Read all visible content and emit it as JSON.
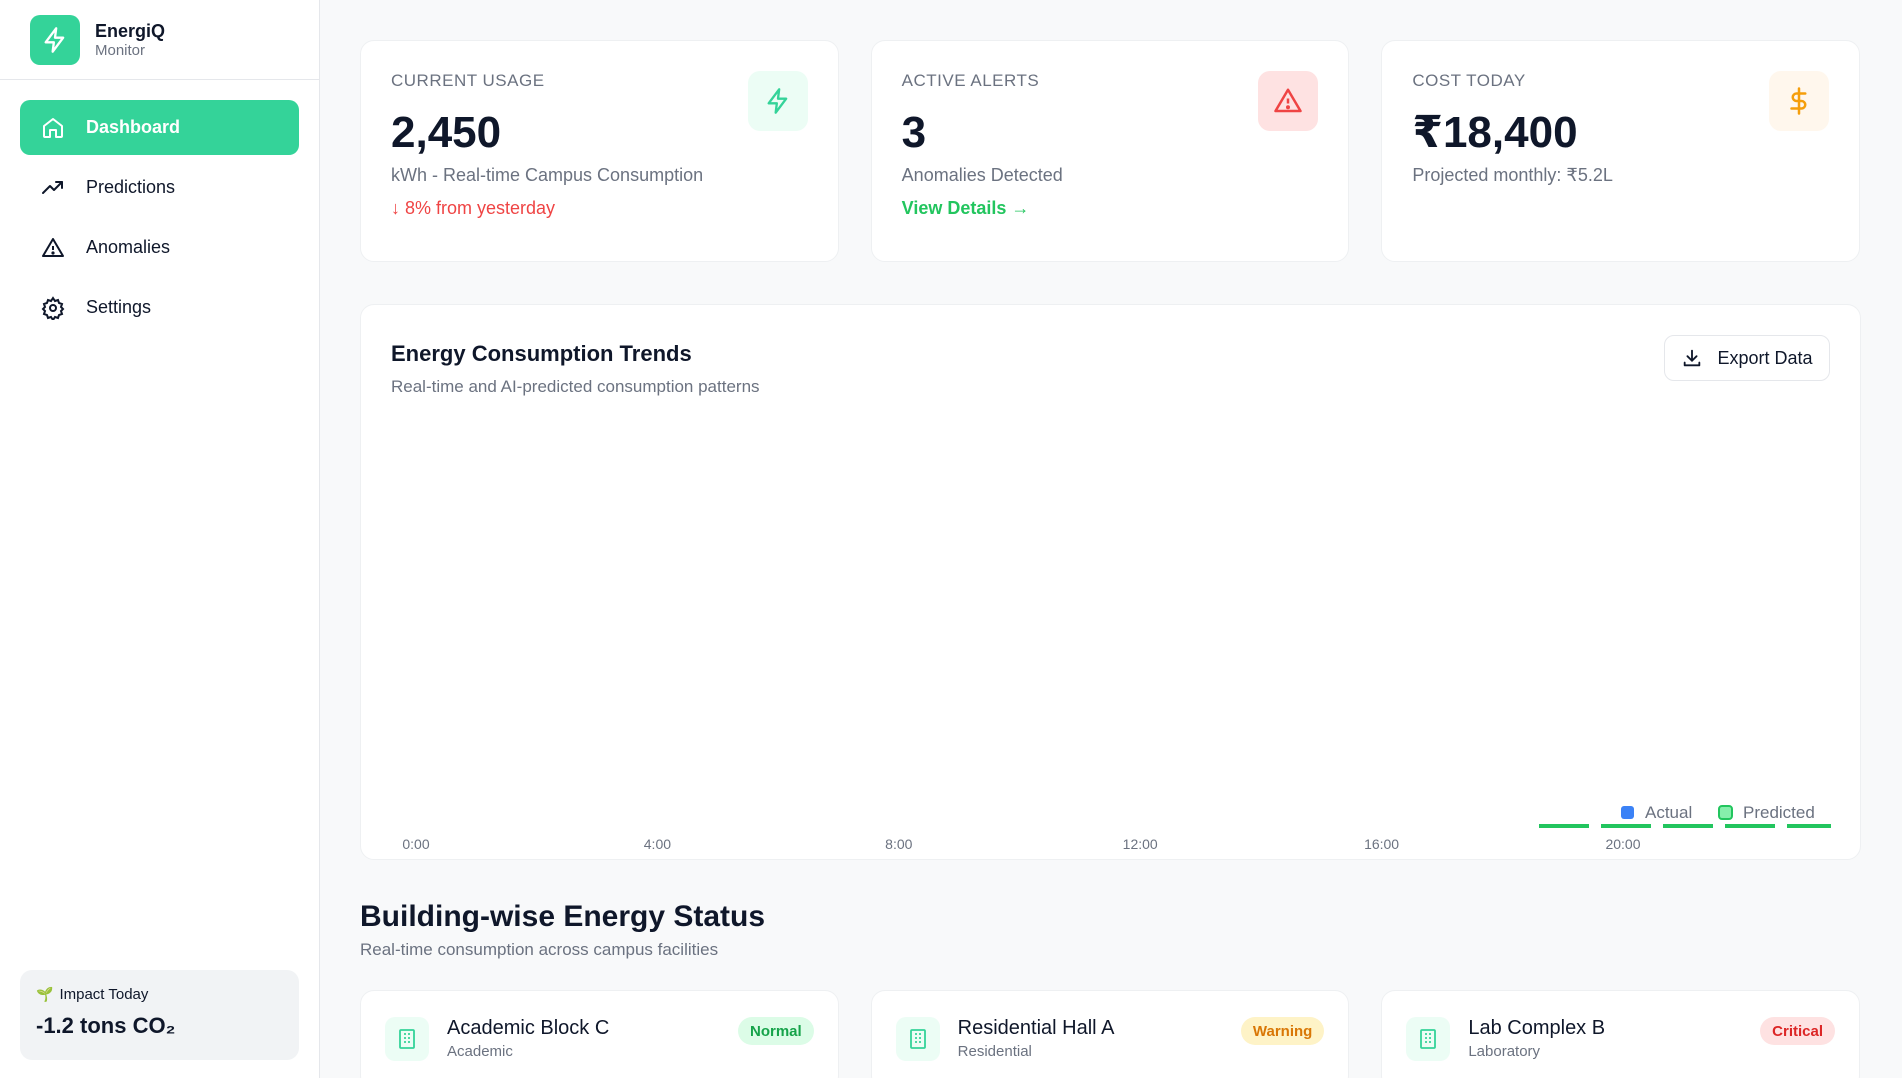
{
  "brand": {
    "name": "EnergiQ",
    "subtitle": "Monitor"
  },
  "nav": [
    {
      "label": "Dashboard",
      "icon": "home-icon",
      "active": true
    },
    {
      "label": "Predictions",
      "icon": "trending-up-icon",
      "active": false
    },
    {
      "label": "Anomalies",
      "icon": "warning-icon",
      "active": false
    },
    {
      "label": "Settings",
      "icon": "gear-icon",
      "active": false
    }
  ],
  "impact": {
    "label": "Impact Today",
    "value": "-1.2 tons CO₂"
  },
  "stats": [
    {
      "label": "CURRENT USAGE",
      "value": "2,450",
      "desc": "kWh - Real-time Campus Consumption",
      "note": "↓ 8% from yesterday",
      "icon": "lightning-icon"
    },
    {
      "label": "ACTIVE ALERTS",
      "value": "3",
      "desc": "Anomalies Detected",
      "note": "View Details →",
      "icon": "warning-icon"
    },
    {
      "label": "COST TODAY",
      "value": "₹18,400",
      "desc": "Projected monthly: ₹5.2L",
      "note": "",
      "icon": "dollar-icon"
    }
  ],
  "chart": {
    "title": "Energy Consumption Trends",
    "subtitle": "Real-time and AI-predicted consumption patterns",
    "export_label": "Export Data"
  },
  "chart_data": {
    "type": "line",
    "x_ticks": [
      "0:00",
      "4:00",
      "8:00",
      "12:00",
      "16:00",
      "20:00"
    ],
    "legend": [
      "Actual",
      "Predicted"
    ],
    "legend_placement": "bottom-right",
    "series_colors": {
      "Actual": "#3b82f6",
      "Predicted": "#22c55e"
    }
  },
  "buildings_section": {
    "title": "Building-wise Energy Status",
    "subtitle": "Real-time consumption across campus facilities"
  },
  "buildings": [
    {
      "name": "Academic Block C",
      "type": "Academic",
      "status": "Normal"
    },
    {
      "name": "Residential Hall A",
      "type": "Residential",
      "status": "Warning"
    },
    {
      "name": "Lab Complex B",
      "type": "Laboratory",
      "status": "Critical"
    }
  ]
}
